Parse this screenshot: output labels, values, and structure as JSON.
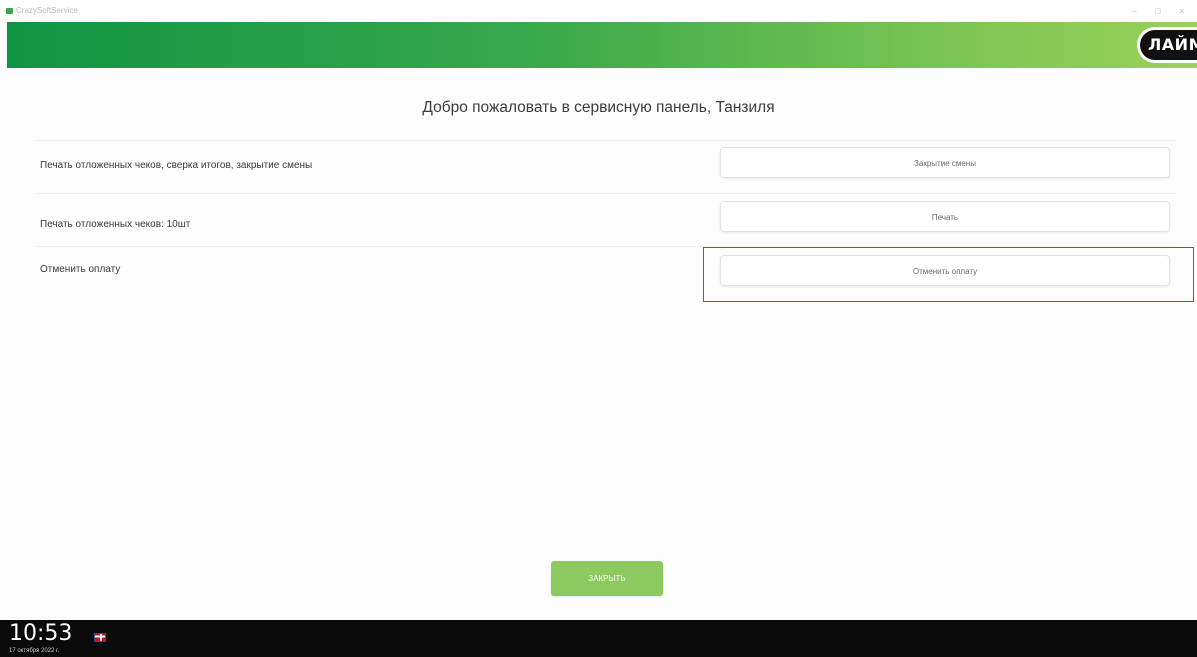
{
  "window": {
    "title": "CrazySoftService",
    "minimize_glyph": "–",
    "maximize_glyph": "□",
    "close_glyph": "×"
  },
  "header": {
    "logo_text": "ЛАЙМ",
    "gradient_start": "#0f9444",
    "gradient_end": "#9bd05b"
  },
  "welcome": "Добро пожаловать в сервисную панель, Танзиля",
  "rows": [
    {
      "label": "Печать отложенных чеков, сверка итогов, закрытие смены",
      "button_label": "Закрытие смены"
    },
    {
      "label": "Печать отложенных чеков: 10шт",
      "button_label": "Печать"
    },
    {
      "label": "Отменить оплату",
      "button_label": "Отменить оплату",
      "highlighted": true,
      "highlight_color": "#c8323c"
    }
  ],
  "close_button": {
    "label": "ЗАКРЫТЬ",
    "color": "#8cc95f"
  },
  "taskbar": {
    "time": "10:53",
    "date": "17 октября 2022 г.",
    "keyboard_layout_icon": "uk-flag-icon"
  }
}
